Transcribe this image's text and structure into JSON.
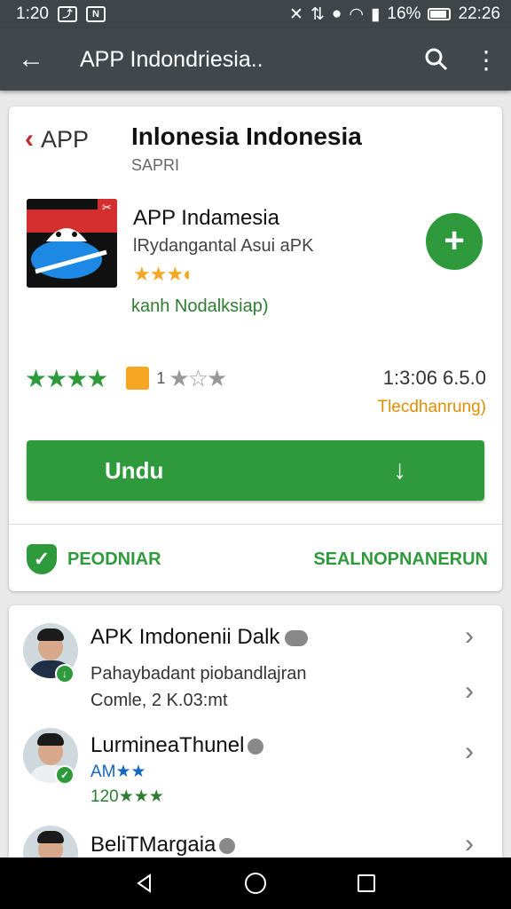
{
  "status_bar": {
    "time": "1:20",
    "battery": "16%",
    "clock": "22:26",
    "notif_icon": "N"
  },
  "app_bar": {
    "title": "APP  Indondriesia.."
  },
  "header": {
    "breadcrumb": "APP",
    "title": "Inlonesia Indonesia",
    "subtitle": "SAPRI"
  },
  "app": {
    "name": "APP Indamesia",
    "developer": "lRydangantal Asui aPK",
    "stars": "★★★◐",
    "note": "kanh  Nodalksiap)"
  },
  "rating": {
    "green_stars": "★★★★",
    "count": "1",
    "grey_stars": "★☆★",
    "size": "1:3:06 6.5.0",
    "trend": "Tlecdhanrung)"
  },
  "install_button": {
    "label": "Undu"
  },
  "footer": {
    "left": "PEODNIAR",
    "right": "SEALNOPNANERUN"
  },
  "list": [
    {
      "title": "APK Imdonenii Dalk",
      "line1": "Pahaybadant piobandlajran",
      "line2": "Comle, 2 K.03:mt"
    },
    {
      "title": "LurmineaThunel",
      "line1": "AM★★",
      "line2": "120★★★"
    },
    {
      "title": "BeliTMargaia"
    }
  ],
  "colors": {
    "accent_green": "#2e9a3c",
    "toolbar": "#41474b",
    "star_orange": "#f5a623"
  }
}
